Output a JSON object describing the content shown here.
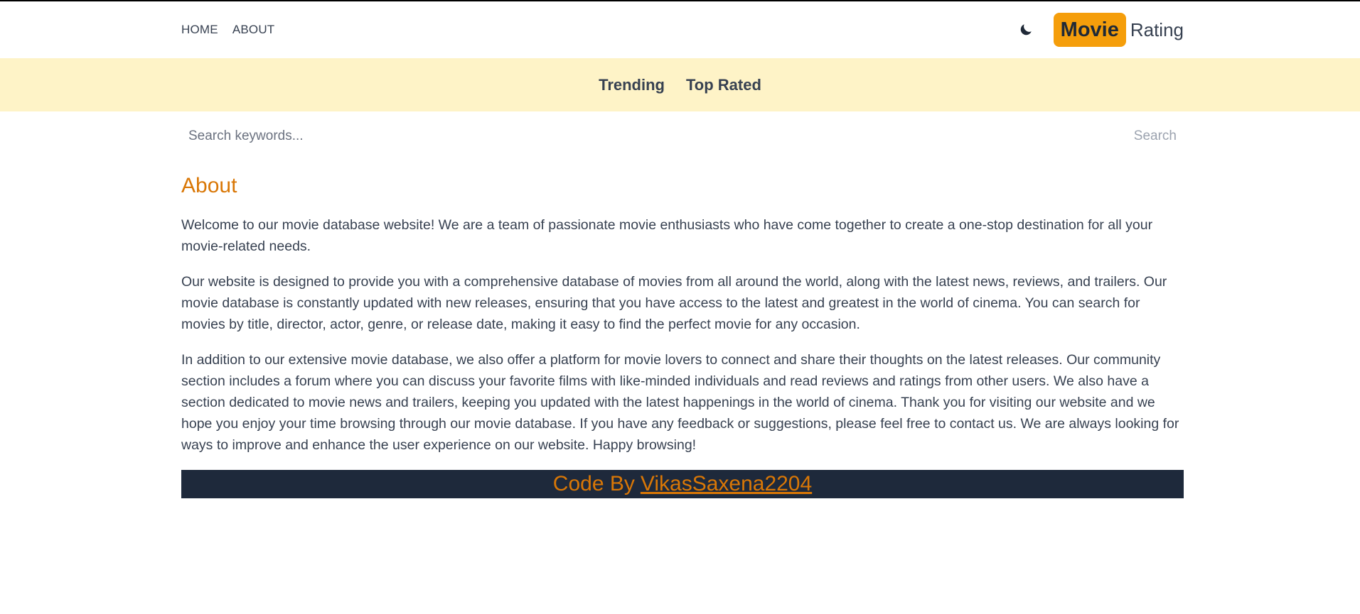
{
  "header": {
    "nav": [
      {
        "label": "HOME"
      },
      {
        "label": "ABOUT"
      }
    ],
    "theme_toggle_icon": "moon-icon",
    "logo": {
      "badge": "Movie",
      "text": "Rating"
    }
  },
  "subnav": {
    "items": [
      {
        "label": "Trending"
      },
      {
        "label": "Top Rated"
      }
    ]
  },
  "search": {
    "placeholder": "Search keywords...",
    "value": "",
    "button_label": "Search"
  },
  "about": {
    "title": "About",
    "paragraphs": [
      "Welcome to our movie database website! We are a team of passionate movie enthusiasts who have come together to create a one-stop destination for all your movie-related needs.",
      "Our website is designed to provide you with a comprehensive database of movies from all around the world, along with the latest news, reviews, and trailers. Our movie database is constantly updated with new releases, ensuring that you have access to the latest and greatest in the world of cinema. You can search for movies by title, director, actor, genre, or release date, making it easy to find the perfect movie for any occasion.",
      "In addition to our extensive movie database, we also offer a platform for movie lovers to connect and share their thoughts on the latest releases. Our community section includes a forum where you can discuss your favorite films with like-minded individuals and read reviews and ratings from other users. We also have a section dedicated to movie news and trailers, keeping you updated with the latest happenings in the world of cinema. Thank you for visiting our website and we hope you enjoy your time browsing through our movie database. If you have any feedback or suggestions, please feel free to contact us. We are always looking for ways to improve and enhance the user experience on our website. Happy browsing!"
    ]
  },
  "footer": {
    "prefix": "Code By",
    "link_label": "VikasSaxena2204"
  },
  "colors": {
    "accent": "#d97706",
    "logo_badge": "#f59e0b",
    "subnav_bg": "#fef3c7",
    "footer_bg": "#1e293b",
    "text": "#374151"
  }
}
